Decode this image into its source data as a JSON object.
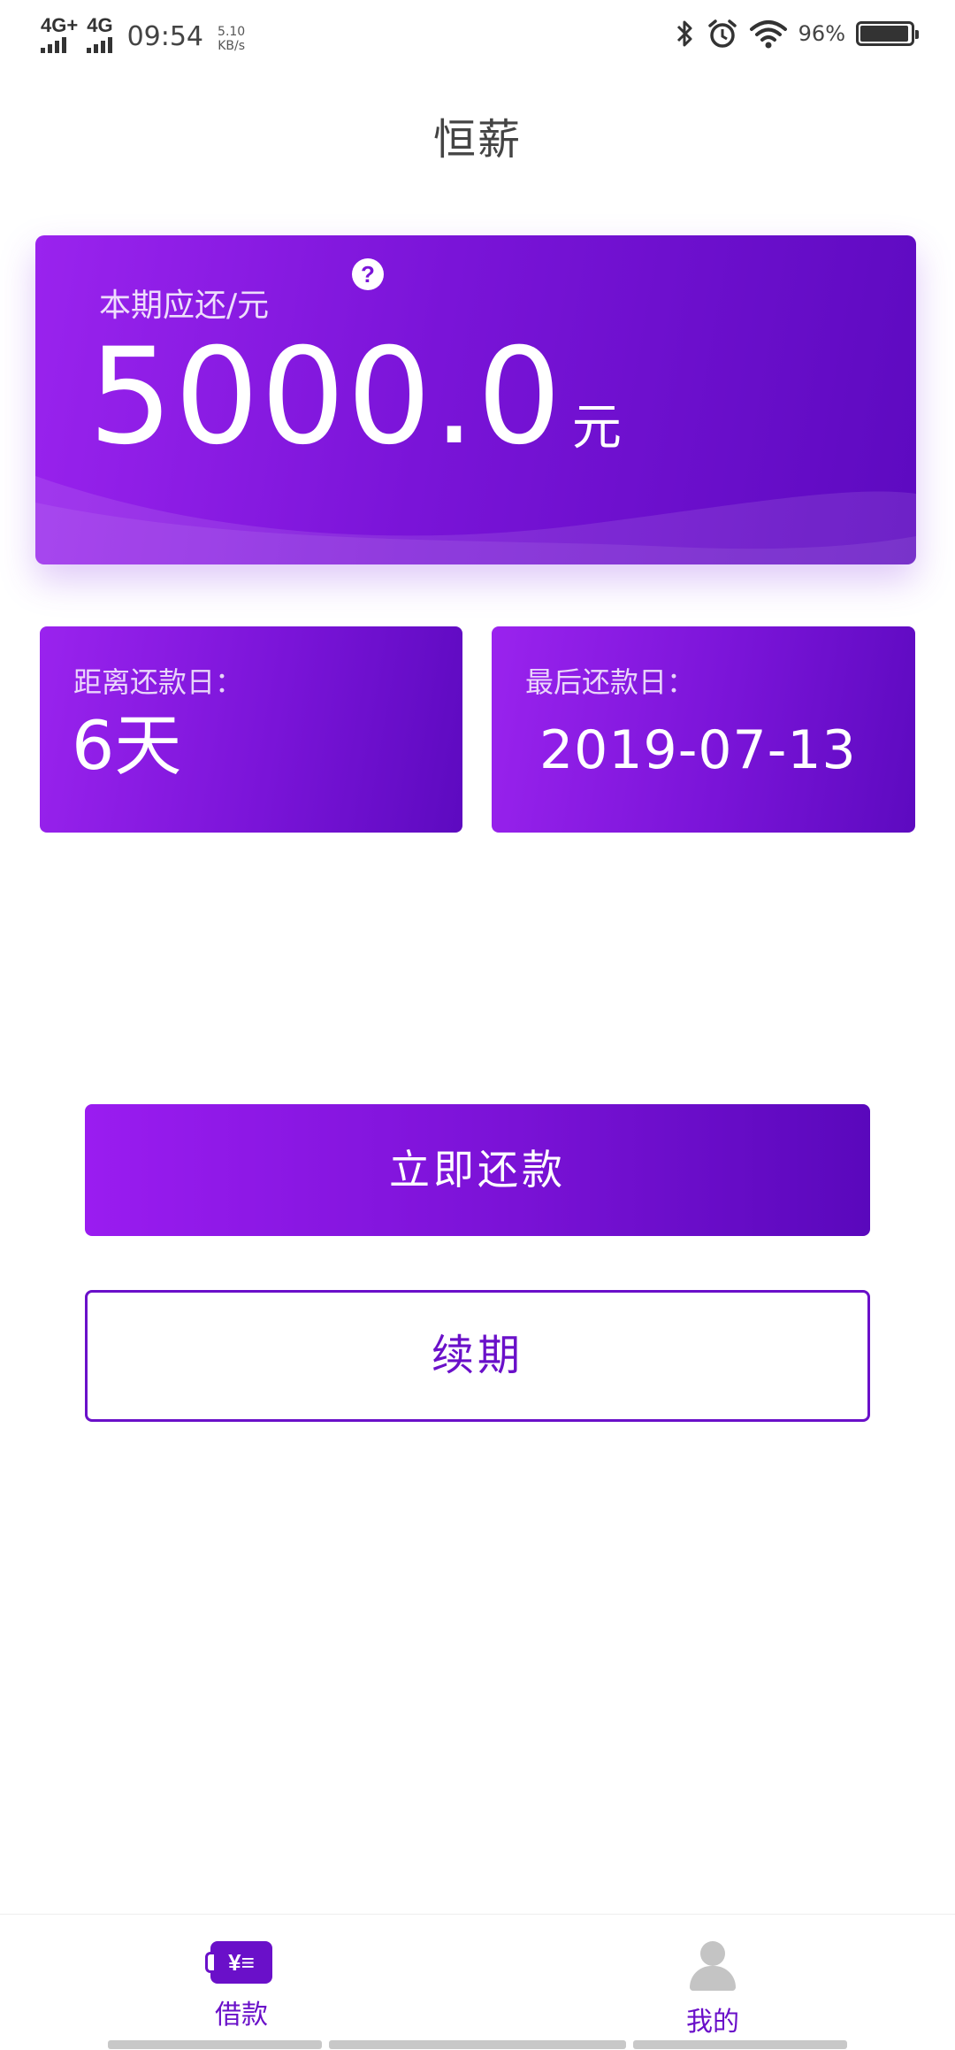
{
  "status_bar": {
    "network_1": "4G+",
    "network_2": "4G",
    "time": "09:54",
    "speed_value": "5.10",
    "speed_unit": "KB/s",
    "battery_text": "96%",
    "battery_level": 0.96
  },
  "header": {
    "title": "恒薪"
  },
  "repayment_card": {
    "label": "本期应还/元",
    "help_symbol": "?",
    "amount": "5000.0",
    "unit": "元"
  },
  "days_card": {
    "label": "距离还款日：",
    "value": "6天"
  },
  "deadline_card": {
    "label": "最后还款日：",
    "value": "2019-07-13"
  },
  "actions": {
    "repay_now_label": "立即还款",
    "renew_label": "续期"
  },
  "bottom_nav": {
    "items": [
      {
        "label": "借款",
        "icon": "loan-icon",
        "active": true
      },
      {
        "label": "我的",
        "icon": "user-icon",
        "active": false
      }
    ]
  },
  "colors": {
    "accent": "#6a10c9",
    "gradient_start": "#9a23ee",
    "gradient_end": "#5d0ac0"
  }
}
